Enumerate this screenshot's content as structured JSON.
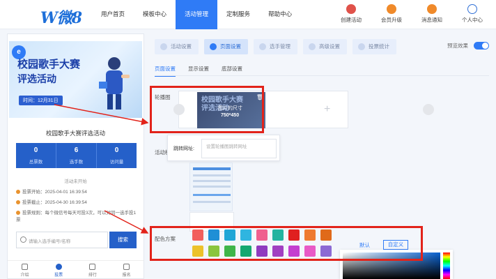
{
  "brand": {
    "logo_text": "W微8",
    "accent": "#2f7bf6"
  },
  "nav": {
    "items": [
      {
        "label": "用户首页",
        "active": false
      },
      {
        "label": "模板中心",
        "active": false
      },
      {
        "label": "活动管理",
        "active": true
      },
      {
        "label": "定制服务",
        "active": false
      },
      {
        "label": "帮助中心",
        "active": false
      }
    ]
  },
  "top_actions": [
    {
      "label": "创建活动",
      "icon": "create-activity-icon",
      "color": "#e0524a"
    },
    {
      "label": "会员升级",
      "icon": "vip-icon",
      "color": "#f08a2a"
    },
    {
      "label": "消息通知",
      "icon": "bell-icon",
      "color": "#f08a2a"
    },
    {
      "label": "个人中心",
      "icon": "user-icon",
      "color": "#2f6fd6"
    }
  ],
  "preview": {
    "banner": {
      "badge": "e",
      "line1": "校园歌手大赛",
      "line2": "评选活动",
      "date": "时间：12月31日"
    },
    "activity_title": "校园歌手大赛评选活动",
    "stats": [
      {
        "value": "0",
        "label": "总票数"
      },
      {
        "value": "6",
        "label": "选手数"
      },
      {
        "value": "0",
        "label": "访问量"
      }
    ],
    "status": "活动未开始",
    "info": {
      "start": "投票开始：2025-04-01 16:39:54",
      "end": "投票截止：2025-04-30 16:39:54",
      "rule": "投票规则：每个微信号每天可投3次，可以对同一选手投1票"
    },
    "search": {
      "placeholder": "请输入选手编号/名称",
      "button": "搜索"
    },
    "tabbar": [
      {
        "label": "介绍",
        "active": false
      },
      {
        "label": "投票",
        "active": true
      },
      {
        "label": "排行",
        "active": false
      },
      {
        "label": "报名",
        "active": false
      }
    ]
  },
  "settings": {
    "tabs": [
      {
        "label": "活动设置",
        "active": false
      },
      {
        "label": "页面设置",
        "active": true
      },
      {
        "label": "选手管理",
        "active": false
      },
      {
        "label": "高级设置",
        "active": false
      },
      {
        "label": "投票统计",
        "active": false
      }
    ],
    "preview_toggle_label": "预览效果",
    "preview_toggle_on": true,
    "subtabs": [
      {
        "label": "页面设置",
        "active": true
      },
      {
        "label": "显示设置",
        "active": false
      },
      {
        "label": "底部设置",
        "active": false
      }
    ],
    "carousel_label": "轮播图",
    "carousel_image": {
      "text": "校园歌手大赛评选活动",
      "overlay1": "图片的尺寸",
      "overlay2": "750*450",
      "delete_glyph": "🗑"
    },
    "add_glyph": "+",
    "popover": {
      "label": "跳转网址:",
      "placeholder": "设置轮播图跳转网址"
    },
    "template_label": "活动模",
    "color_scheme_label": "配色方案",
    "colors_row1": [
      "#f25f5c",
      "#1f8fd6",
      "#21a6d6",
      "#2fb5e0",
      "#ef5f8f",
      "#23b3a0",
      "#e02020",
      "#ee7a2f",
      "#e06a1a"
    ],
    "colors_row2": [
      "#ecc22a",
      "#8ac53e",
      "#3fb54a",
      "#16a870",
      "#8f3bbf",
      "#a13fc1",
      "#c43fcf",
      "#e85ac6",
      "#8c6ad4"
    ],
    "default_label": "默认",
    "custom_label": "自定义"
  }
}
